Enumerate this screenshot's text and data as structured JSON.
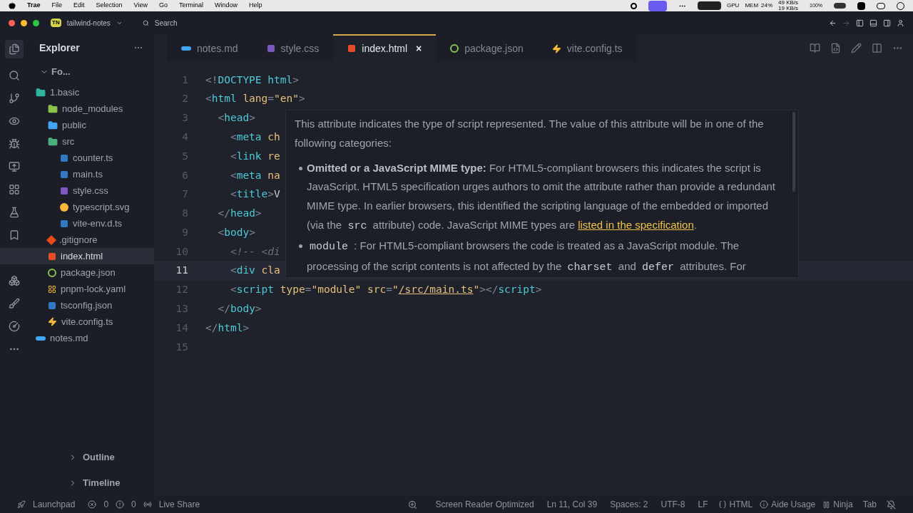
{
  "menubar": {
    "app": "Trae",
    "items": [
      "File",
      "Edit",
      "Selection",
      "View",
      "Go",
      "Terminal",
      "Window",
      "Help"
    ],
    "gpu": "GPU",
    "mem_label": "MEM",
    "mem": "24%",
    "up": "49 KB/s",
    "down": "19 KB/s",
    "battery": "100%"
  },
  "titlebar": {
    "badge": "TN",
    "project": "tailwind-notes",
    "search": "Search"
  },
  "sidebar": {
    "title": "Explorer",
    "section": "Fo...",
    "tree": [
      {
        "name": "1.basic",
        "kind": "folder",
        "selected": false,
        "children": [
          {
            "name": "node_modules",
            "kind": "folder",
            "selected": false
          },
          {
            "name": "public",
            "kind": "folder",
            "selected": false
          },
          {
            "name": "src",
            "kind": "folder",
            "selected": false,
            "children": [
              {
                "name": "counter.ts",
                "kind": "ts",
                "selected": false
              },
              {
                "name": "main.ts",
                "kind": "ts",
                "selected": false
              },
              {
                "name": "style.css",
                "kind": "css",
                "selected": false
              },
              {
                "name": "typescript.svg",
                "kind": "image",
                "selected": false
              },
              {
                "name": "vite-env.d.ts",
                "kind": "ts",
                "selected": false
              }
            ]
          },
          {
            "name": ".gitignore",
            "kind": "git",
            "selected": false
          },
          {
            "name": "index.html",
            "kind": "html",
            "selected": true
          },
          {
            "name": "package.json",
            "kind": "package",
            "selected": false
          },
          {
            "name": "pnpm-lock.yaml",
            "kind": "lock",
            "selected": false
          },
          {
            "name": "tsconfig.json",
            "kind": "ts",
            "selected": false
          },
          {
            "name": "vite.config.ts",
            "kind": "vite",
            "selected": false
          }
        ]
      },
      {
        "name": "notes.md",
        "kind": "markdown",
        "selected": false
      }
    ],
    "panels": [
      "Outline",
      "Timeline"
    ]
  },
  "tabs": [
    {
      "label": "notes.md",
      "kind": "markdown",
      "selected": false
    },
    {
      "label": "style.css",
      "kind": "css",
      "selected": false
    },
    {
      "label": "index.html",
      "kind": "html",
      "selected": true,
      "close": "×"
    },
    {
      "label": "package.json",
      "kind": "package",
      "selected": false
    },
    {
      "label": "vite.config.ts",
      "kind": "vite",
      "selected": false
    }
  ],
  "editor": {
    "lines": [
      {
        "number": "1",
        "current": false,
        "text": "<!DOCTYPE html>"
      },
      {
        "number": "2",
        "current": false,
        "text": "<html lang=\"en\">"
      },
      {
        "number": "3",
        "current": false,
        "text": "  <head>"
      },
      {
        "number": "4",
        "current": false,
        "text": "    <meta ch"
      },
      {
        "number": "5",
        "current": false,
        "text": "    <link re"
      },
      {
        "number": "6",
        "current": false,
        "text": "    <meta na"
      },
      {
        "number": "7",
        "current": false,
        "text": "    <title>V"
      },
      {
        "number": "8",
        "current": false,
        "text": "  </head>"
      },
      {
        "number": "9",
        "current": false,
        "text": "  <body>"
      },
      {
        "number": "10",
        "current": false,
        "text": "    <!-- <di"
      },
      {
        "number": "11",
        "current": true,
        "text": "    <div cla"
      },
      {
        "number": "12",
        "current": false,
        "text": "    <script type=\"module\" src=\"/src/main.ts\"></script>"
      },
      {
        "number": "13",
        "current": false,
        "text": "  </body>"
      },
      {
        "number": "14",
        "current": false,
        "text": "</html>"
      },
      {
        "number": "15",
        "current": false
      }
    ]
  },
  "hover": {
    "intro": "This attribute indicates the type of script represented. The value of this attribute will be in one of the following categories:",
    "bullets": [
      [
        {
          "kind": "bold",
          "text": "Omitted or a JavaScript MIME type:"
        },
        {
          "kind": "text",
          "text": "For HTML5-compliant browsers this indicates the script is JavaScript. HTML5 specification urges authors to omit the attribute rather than provide a redundant MIME type. In earlier browsers, this identified the scripting language of the embedded or imported (via the"
        },
        {
          "kind": "code",
          "text": "src"
        },
        {
          "kind": "text",
          "text": "attribute) code. JavaScript MIME types are"
        },
        {
          "kind": "link",
          "text": "listed in the specification"
        },
        {
          "kind": "tail",
          "text": "."
        }
      ],
      [
        {
          "kind": "code",
          "text": "module"
        },
        {
          "kind": "tail",
          "text": ": For HTML5-compliant browsers the code is treated as a JavaScript module. The processing of the script contents is not affected by the"
        },
        {
          "kind": "code",
          "text": "charset"
        },
        {
          "kind": "text",
          "text": "and"
        },
        {
          "kind": "code",
          "text": "defer"
        },
        {
          "kind": "text",
          "text": "attributes. For"
        }
      ]
    ]
  },
  "statusbar": {
    "left": {
      "launchpad": "Launchpad",
      "errors": "0",
      "warnings": "0",
      "share": "Live Share"
    },
    "right": [
      {
        "kind": "zoom"
      },
      {
        "kind": "text",
        "text": "Screen Reader Optimized"
      },
      {
        "kind": "text",
        "text": "Ln 11, Col 39"
      },
      {
        "kind": "text",
        "text": "Spaces: 2"
      },
      {
        "kind": "text",
        "text": "UTF-8"
      },
      {
        "kind": "text",
        "text": "LF"
      },
      {
        "kind": "lang",
        "text": "HTML"
      },
      {
        "kind": "info",
        "text": "Aide Usage"
      },
      {
        "kind": "pause",
        "text": "Ninja"
      },
      {
        "kind": "text",
        "text": "Tab"
      },
      {
        "kind": "bell"
      }
    ]
  }
}
